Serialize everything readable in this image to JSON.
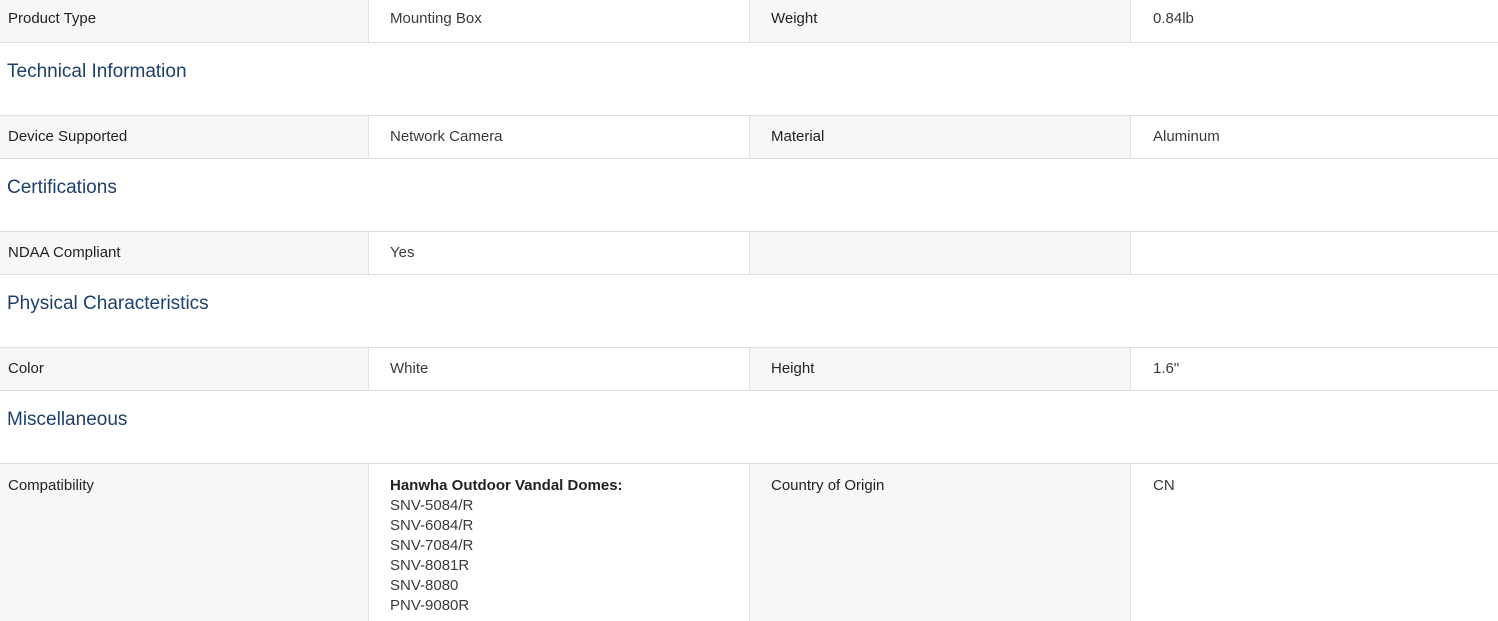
{
  "rows": {
    "product": {
      "label1": "Product Type",
      "value1": "Mounting Box",
      "label2": "Weight",
      "value2": "0.84lb"
    },
    "technical": {
      "label1": "Device Supported",
      "value1": "Network Camera",
      "label2": "Material",
      "value2": "Aluminum"
    },
    "certifications": {
      "label1": "NDAA Compliant",
      "value1": "Yes",
      "label2": "",
      "value2": ""
    },
    "physical": {
      "label1": "Color",
      "value1": "White",
      "label2": "Height",
      "value2": "1.6\""
    },
    "misc": {
      "label1": "Compatibility",
      "compat_title": "Hanwha Outdoor Vandal Domes:",
      "compat_models": [
        "SNV-5084/R",
        "SNV-6084/R",
        "SNV-7084/R",
        "SNV-8081R",
        "SNV-8080",
        "PNV-9080R"
      ],
      "label2": "Country of Origin",
      "value2": "CN"
    }
  },
  "sections": {
    "technical": "Technical Information",
    "certifications": "Certifications",
    "physical": "Physical Characteristics",
    "misc": "Miscellaneous"
  }
}
